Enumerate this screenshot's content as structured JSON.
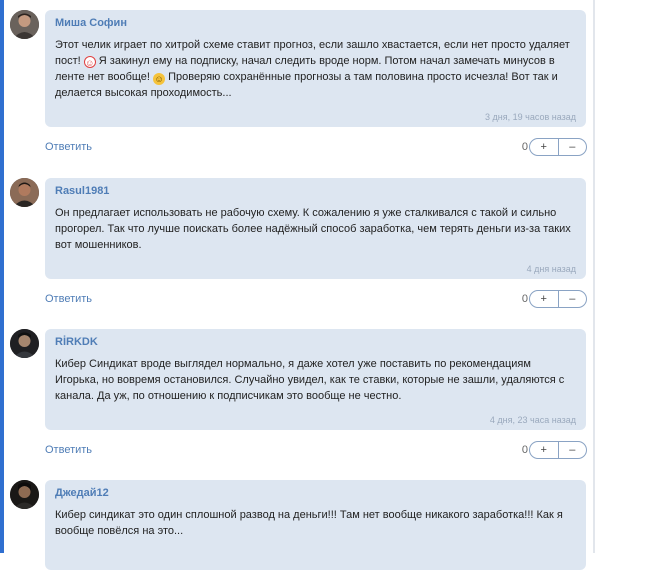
{
  "comments": [
    {
      "author": "Миша Софин",
      "text_parts": [
        "Этот челик играет по хитрой схеме ставит прогноз, если зашло хвастается, если нет просто удаляет пост! ",
        " Я закинул ему на подписку, начал следить вроде норм. Потом начал замечать минусов в ленте нет вообще! ",
        " Проверяю сохранённые прогнозы а там половина просто исчезла! Вот так и делается высокая проходимость..."
      ],
      "emojis": [
        "clown-face",
        "neutral-face"
      ],
      "time": "3 дня, 19 часов назад",
      "reply_label": "Ответить",
      "rating": "0",
      "plus": "+",
      "minus": "–"
    },
    {
      "author": "Rasul1981",
      "text": "Он предлагает использовать не рабочую схему. К сожалению я уже сталкивался с такой и сильно прогорел. Так что лучше поискать более надёжный способ заработка, чем терять деньги из-за таких вот мошенников.",
      "time": "4 дня назад",
      "reply_label": "Ответить",
      "rating": "0",
      "plus": "+",
      "minus": "–"
    },
    {
      "author": "RİRKDK",
      "text": "Кибер Синдикат вроде выглядел нормально, я даже хотел уже поставить по рекомендациям Игорька, но вовремя остановился. Случайно увидел, как те ставки, которые не зашли, удаляются с канала. Да уж, по отношению к подписчикам это вообще не честно.",
      "time": "4 дня, 23 часа назад",
      "reply_label": "Ответить",
      "rating": "0",
      "plus": "+",
      "minus": "–"
    },
    {
      "author": "Джедай12",
      "text": "Кибер синдикат это один сплошной развод на деньги!!! Там нет вообще никакого заработка!!! Как я вообще повёлся на это..."
    }
  ]
}
